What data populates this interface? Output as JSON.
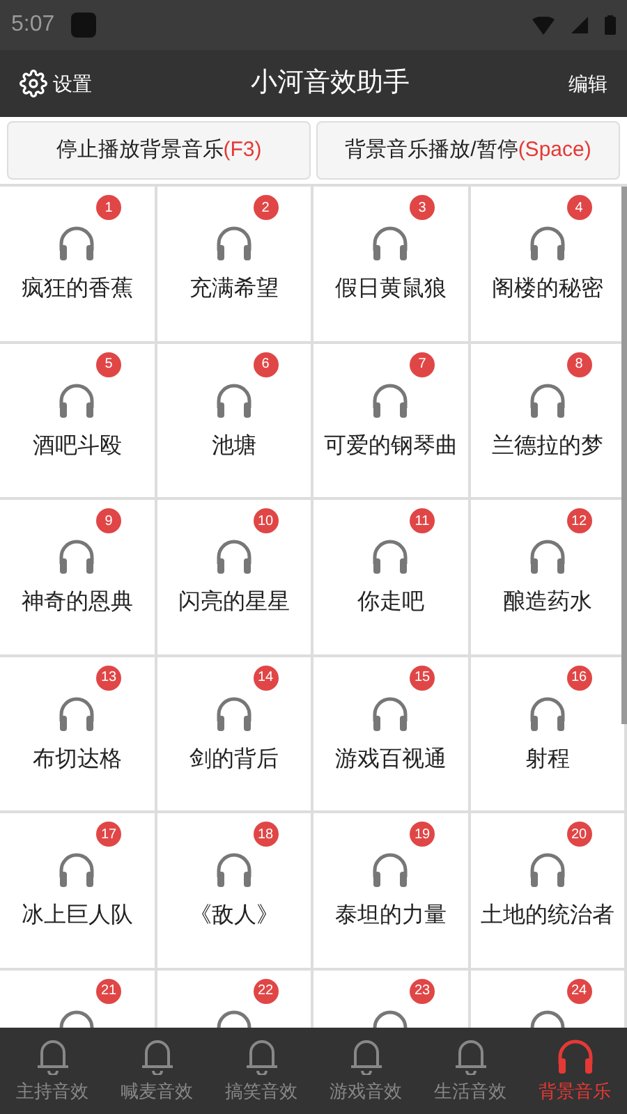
{
  "status_bar": {
    "time": "5:07"
  },
  "header": {
    "settings": "设置",
    "title": "小河音效助手",
    "edit": "编辑"
  },
  "controls": [
    {
      "label": "停止播放背景音乐",
      "key": "(F3)"
    },
    {
      "label": "背景音乐播放/暂停",
      "key": "(Space)"
    }
  ],
  "sounds": [
    {
      "number": "1",
      "name": "疯狂的香蕉"
    },
    {
      "number": "2",
      "name": "充满希望"
    },
    {
      "number": "3",
      "name": "假日黄鼠狼"
    },
    {
      "number": "4",
      "name": "阁楼的秘密"
    },
    {
      "number": "5",
      "name": "酒吧斗殴"
    },
    {
      "number": "6",
      "name": "池塘"
    },
    {
      "number": "7",
      "name": "可爱的钢琴曲"
    },
    {
      "number": "8",
      "name": "兰德拉的梦"
    },
    {
      "number": "9",
      "name": "神奇的恩典"
    },
    {
      "number": "10",
      "name": "闪亮的星星"
    },
    {
      "number": "11",
      "name": "你走吧"
    },
    {
      "number": "12",
      "name": "酿造药水"
    },
    {
      "number": "13",
      "name": "布切达格"
    },
    {
      "number": "14",
      "name": "剑的背后"
    },
    {
      "number": "15",
      "name": "游戏百视通"
    },
    {
      "number": "16",
      "name": "射程"
    },
    {
      "number": "17",
      "name": "冰上巨人队"
    },
    {
      "number": "18",
      "name": "《敌人》"
    },
    {
      "number": "19",
      "name": "泰坦的力量"
    },
    {
      "number": "20",
      "name": "土地的统治者"
    },
    {
      "number": "21"
    },
    {
      "number": "22"
    },
    {
      "number": "23"
    },
    {
      "number": "24"
    }
  ],
  "nav": [
    {
      "label": "主持音效",
      "kind": "bell",
      "selected": false
    },
    {
      "label": "喊麦音效",
      "kind": "bell",
      "selected": false
    },
    {
      "label": "搞笑音效",
      "kind": "bell",
      "selected": false
    },
    {
      "label": "游戏音效",
      "kind": "bell",
      "selected": false
    },
    {
      "label": "生活音效",
      "kind": "bell",
      "selected": false
    },
    {
      "label": "背景音乐",
      "kind": "headphones",
      "selected": true
    }
  ]
}
